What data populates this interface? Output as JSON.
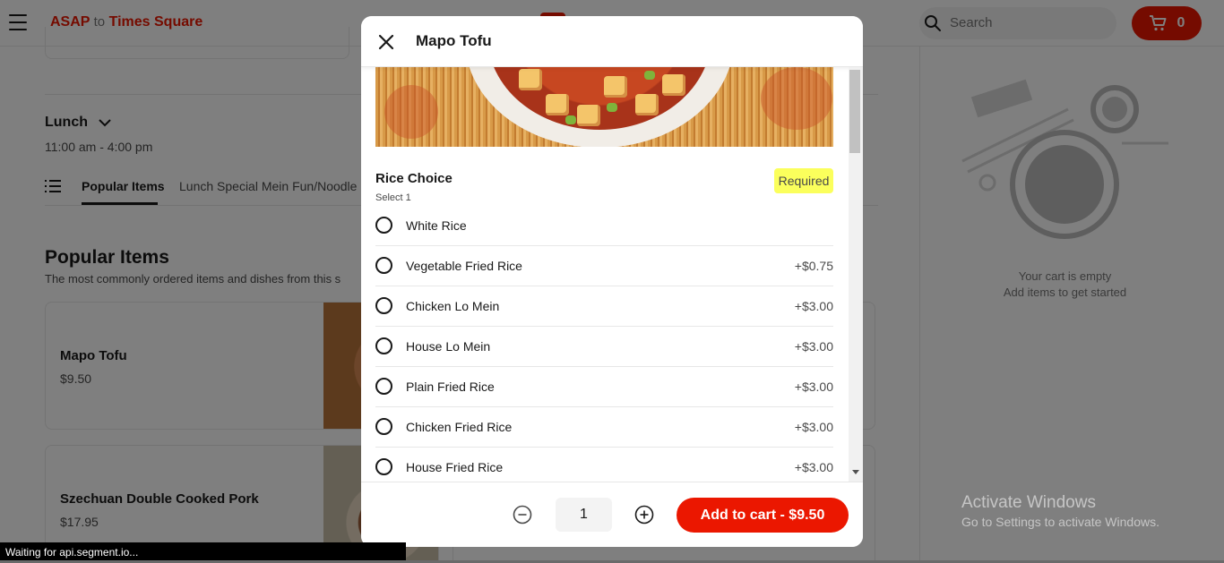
{
  "header": {
    "address_primary": "ASAP",
    "address_connector": "to",
    "address_location": "Times Square",
    "search_placeholder": "Search",
    "cart_count": "0"
  },
  "menu": {
    "menu_name": "Lunch",
    "hours": "11:00 am - 4:00 pm",
    "category_tabs": [
      "Popular Items",
      "Lunch Special Mein Fun/Noodle"
    ],
    "section_title": "Popular Items",
    "section_subtitle": "The most commonly ordered items and dishes from this s",
    "items": [
      {
        "name": "Mapo Tofu",
        "price": "$9.50"
      },
      {
        "name": "Szechuan Double Cooked Pork",
        "price": "$17.95"
      }
    ]
  },
  "cart": {
    "empty_line1": "Your cart is empty",
    "empty_line2": "Add items to get started"
  },
  "modal": {
    "title": "Mapo Tofu",
    "option_group": {
      "title": "Rice Choice",
      "subtitle": "Select 1",
      "required_label": "Required",
      "options": [
        {
          "label": "White Rice",
          "price": ""
        },
        {
          "label": "Vegetable Fried Rice",
          "price": "+$0.75"
        },
        {
          "label": "Chicken Lo Mein",
          "price": "+$3.00"
        },
        {
          "label": "House Lo Mein",
          "price": "+$3.00"
        },
        {
          "label": "Plain Fried Rice",
          "price": "+$3.00"
        },
        {
          "label": "Chicken Fried Rice",
          "price": "+$3.00"
        },
        {
          "label": "House Fried Rice",
          "price": "+$3.00"
        }
      ]
    },
    "quantity": "1",
    "add_to_cart_label": "Add to cart - $9.50"
  },
  "system": {
    "status_text": "Waiting for api.segment.io...",
    "watermark_title": "Activate Windows",
    "watermark_subtitle": "Go to Settings to activate Windows."
  },
  "icons": {
    "menu": "hamburger-icon",
    "search": "search-icon",
    "cart": "cart-icon",
    "close": "close-icon",
    "minus": "minus-circle-icon",
    "plus": "plus-circle-icon",
    "list": "list-icon",
    "chevron": "chevron-down-icon"
  },
  "colors": {
    "brand_red": "#eb1700",
    "required_badge": "#fbff5c"
  }
}
